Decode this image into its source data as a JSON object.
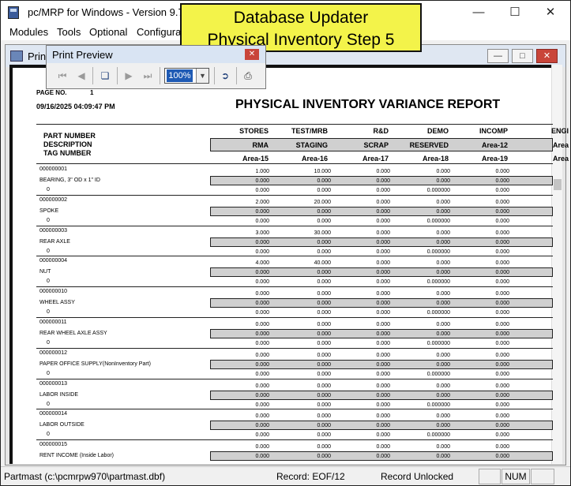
{
  "window": {
    "title": "pc/MRP for Windows - Version 9.70L"
  },
  "menu": [
    "Modules",
    "Tools",
    "Optional",
    "Configurati"
  ],
  "banner": {
    "line1": "Database Updater",
    "line2": "Physical Inventory Step 5"
  },
  "child_window": {
    "title": "Prin"
  },
  "print_preview": {
    "title": "Print Preview",
    "zoom": "100%"
  },
  "report": {
    "page_label": "PAGE NO.",
    "page_no": "1",
    "datetime": "09/16/2025 04:09:47 PM",
    "title": "PHYSICAL INVENTORY VARIANCE REPORT",
    "left_headers": [
      "PART NUMBER",
      "DESCRIPTION",
      "TAG NUMBER"
    ],
    "header_row1": [
      "STORES",
      "TEST/MRB",
      "R&D",
      "DEMO",
      "INCOMP",
      "ENGI"
    ],
    "header_row2": [
      "RMA",
      "STAGING",
      "SCRAP",
      "RESERVED",
      "Area-12",
      "Area"
    ],
    "header_row3": [
      "Area-15",
      "Area-16",
      "Area-17",
      "Area-18",
      "Area-19",
      "Area"
    ],
    "parts": [
      {
        "part": "000000001",
        "desc": "BEARING, 3\" OD x 1\" ID",
        "tag": "0",
        "r1": [
          "1.000",
          "10.000",
          "0.000",
          "0.000",
          "0.000"
        ],
        "r2": [
          "0.000",
          "0.000",
          "0.000",
          "0.000",
          "0.000"
        ],
        "r3": [
          "0.000",
          "0.000",
          "0.000",
          "0.000000",
          "0.000"
        ]
      },
      {
        "part": "000000002",
        "desc": "SPOKE",
        "tag": "0",
        "r1": [
          "2.000",
          "20.000",
          "0.000",
          "0.000",
          "0.000"
        ],
        "r2": [
          "0.000",
          "0.000",
          "0.000",
          "0.000",
          "0.000"
        ],
        "r3": [
          "0.000",
          "0.000",
          "0.000",
          "0.000000",
          "0.000"
        ]
      },
      {
        "part": "000000003",
        "desc": "REAR AXLE",
        "tag": "0",
        "r1": [
          "3.000",
          "30.000",
          "0.000",
          "0.000",
          "0.000"
        ],
        "r2": [
          "0.000",
          "0.000",
          "0.000",
          "0.000",
          "0.000"
        ],
        "r3": [
          "0.000",
          "0.000",
          "0.000",
          "0.000000",
          "0.000"
        ]
      },
      {
        "part": "000000004",
        "desc": "NUT",
        "tag": "0",
        "r1": [
          "4.000",
          "40.000",
          "0.000",
          "0.000",
          "0.000"
        ],
        "r2": [
          "0.000",
          "0.000",
          "0.000",
          "0.000",
          "0.000"
        ],
        "r3": [
          "0.000",
          "0.000",
          "0.000",
          "0.000000",
          "0.000"
        ]
      },
      {
        "part": "000000010",
        "desc": "WHEEL ASSY",
        "tag": "0",
        "r1": [
          "0.000",
          "0.000",
          "0.000",
          "0.000",
          "0.000"
        ],
        "r2": [
          "0.000",
          "0.000",
          "0.000",
          "0.000",
          "0.000"
        ],
        "r3": [
          "0.000",
          "0.000",
          "0.000",
          "0.000000",
          "0.000"
        ]
      },
      {
        "part": "000000011",
        "desc": "REAR WHEEL AXLE ASSY",
        "tag": "0",
        "r1": [
          "0.000",
          "0.000",
          "0.000",
          "0.000",
          "0.000"
        ],
        "r2": [
          "0.000",
          "0.000",
          "0.000",
          "0.000",
          "0.000"
        ],
        "r3": [
          "0.000",
          "0.000",
          "0.000",
          "0.000000",
          "0.000"
        ]
      },
      {
        "part": "000000012",
        "desc": "PAPER OFFICE SUPPLY(NonInventory Part)",
        "tag": "0",
        "r1": [
          "0.000",
          "0.000",
          "0.000",
          "0.000",
          "0.000"
        ],
        "r2": [
          "0.000",
          "0.000",
          "0.000",
          "0.000",
          "0.000"
        ],
        "r3": [
          "0.000",
          "0.000",
          "0.000",
          "0.000000",
          "0.000"
        ]
      },
      {
        "part": "000000013",
        "desc": "LABOR INSIDE",
        "tag": "0",
        "r1": [
          "0.000",
          "0.000",
          "0.000",
          "0.000",
          "0.000"
        ],
        "r2": [
          "0.000",
          "0.000",
          "0.000",
          "0.000",
          "0.000"
        ],
        "r3": [
          "0.000",
          "0.000",
          "0.000",
          "0.000000",
          "0.000"
        ]
      },
      {
        "part": "000000014",
        "desc": "LABOR OUTSIDE",
        "tag": "0",
        "r1": [
          "0.000",
          "0.000",
          "0.000",
          "0.000",
          "0.000"
        ],
        "r2": [
          "0.000",
          "0.000",
          "0.000",
          "0.000",
          "0.000"
        ],
        "r3": [
          "0.000",
          "0.000",
          "0.000",
          "0.000000",
          "0.000"
        ]
      },
      {
        "part": "000000015",
        "desc": "RENT INCOME (Inside Labor)",
        "tag": "",
        "r1": [
          "0.000",
          "0.000",
          "0.000",
          "0.000",
          "0.000"
        ],
        "r2": [
          "0.000",
          "0.000",
          "0.000",
          "0.000",
          "0.000"
        ],
        "r3": []
      }
    ]
  },
  "status": {
    "file": "Partmast (c:\\pcmrpw970\\partmast.dbf)",
    "record": "Record: EOF/12",
    "lock": "Record Unlocked",
    "num": "NUM"
  }
}
